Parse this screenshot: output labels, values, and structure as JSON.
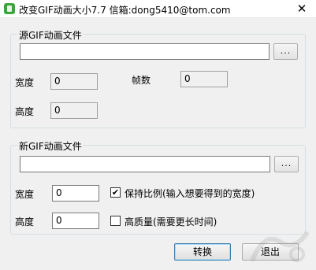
{
  "window": {
    "title": "改变GIF动画大小7.7  信箱:dong5410@tom.com",
    "close_glyph": "✕"
  },
  "source_group": {
    "legend": "源GIF动画文件",
    "file_path": "",
    "browse_label": "...",
    "width_label": "宽度",
    "width_value": "0",
    "frames_label": "帧数",
    "frames_value": "0",
    "height_label": "高度",
    "height_value": "0"
  },
  "new_group": {
    "legend": "新GIF动画文件",
    "file_path": "",
    "browse_label": "...",
    "width_label": "宽度",
    "width_value": "0",
    "keep_ratio_label": "保持比例(输入想要得到的宽度)",
    "keep_ratio_checked": true,
    "check_glyph": "✔",
    "height_label": "高度",
    "height_value": "0",
    "high_quality_label": "高质量(需要更长时间)",
    "high_quality_checked": false
  },
  "buttons": {
    "convert_label": "转换",
    "exit_label": "退出"
  },
  "icons": {
    "app": "app-icon",
    "close": "close-icon",
    "checkbox_checked": "check-icon"
  },
  "colors": {
    "background": "#f0f0f0",
    "titlebar": "#ffffff",
    "group_border": "#d5dfe5",
    "textbox_border": "#7a7a7a",
    "app_icon": "#3aa53a"
  }
}
